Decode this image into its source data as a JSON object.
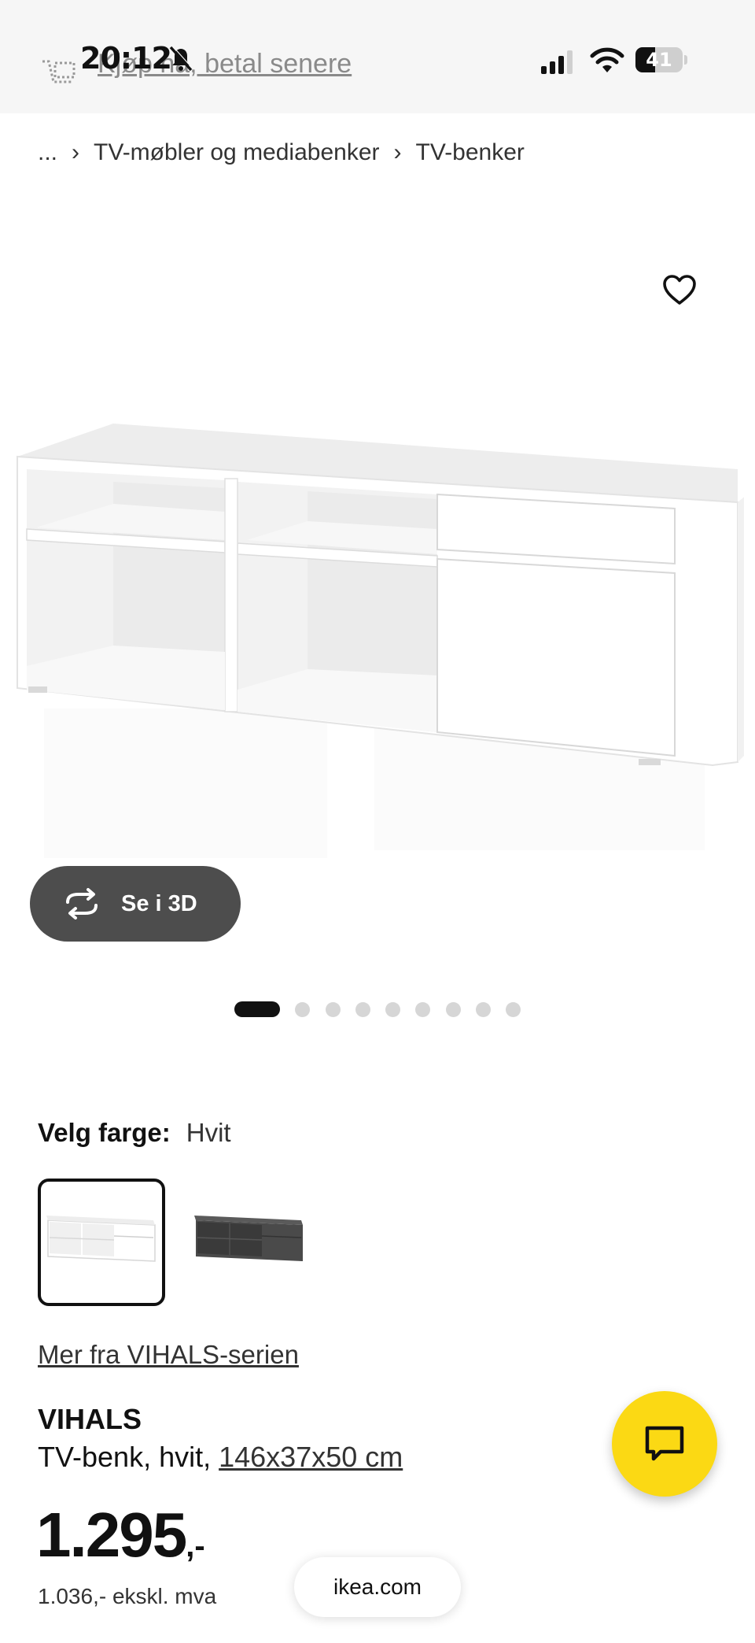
{
  "status_bar": {
    "time": "20:12",
    "battery_level": 41,
    "battery_text": "41"
  },
  "header": {
    "ghost_link": "Kjøp nå, betal senere"
  },
  "breadcrumb": {
    "ellipsis": "...",
    "separator": "›",
    "items": [
      "TV-møbler og mediabenker",
      "TV-benker"
    ]
  },
  "media": {
    "view_3d_label": "Se i 3D",
    "carousel_total": 9,
    "carousel_active": 1
  },
  "color": {
    "label": "Velg farge:",
    "value": "Hvit"
  },
  "series_link": "Mer fra VIHALS-serien",
  "product": {
    "name": "VIHALS",
    "desc_prefix": "TV-benk, hvit, ",
    "size": "146x37x50 cm",
    "price": "1.295",
    "price_suffix": ",-",
    "price_ex_vat": "1.036,- ekskl. mva"
  },
  "browser": {
    "url": "ikea.com"
  },
  "colors": {
    "chat_button": "#fbd914",
    "view_3d_bg": "#4d4d4d",
    "dot_active": "#111111",
    "dot_inactive": "#d6d6d6"
  },
  "icons": {
    "favorite": "heart-icon",
    "chat": "chat-icon",
    "view_3d": "rotate-icon",
    "status": [
      "mute-icon",
      "signal-icon",
      "wifi-icon",
      "battery-icon"
    ]
  }
}
